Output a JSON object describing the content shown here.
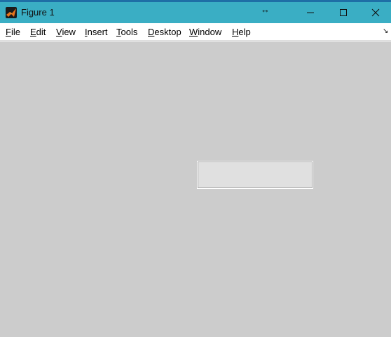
{
  "window": {
    "title": "Figure 1",
    "resize_glyph": "↔",
    "icons": {
      "app": "matlab-logo-icon",
      "minimize": "minimize-icon",
      "maximize": "maximize-icon",
      "close": "close-icon"
    },
    "colors": {
      "titlebar": "#3aaec4",
      "menubar": "#ffffff",
      "canvas": "#cccccc",
      "panel": "#e0e0e0"
    }
  },
  "menu": {
    "items": [
      {
        "acc": "F",
        "rest": "ile"
      },
      {
        "acc": "E",
        "rest": "dit"
      },
      {
        "acc": "V",
        "rest": "iew"
      },
      {
        "acc": "I",
        "rest": "nsert"
      },
      {
        "acc": "T",
        "rest": "ools"
      },
      {
        "acc": "D",
        "rest": "esktop"
      },
      {
        "acc": "W",
        "rest": "indow"
      },
      {
        "acc": "H",
        "rest": "elp"
      }
    ],
    "dock_glyph": "↘"
  }
}
